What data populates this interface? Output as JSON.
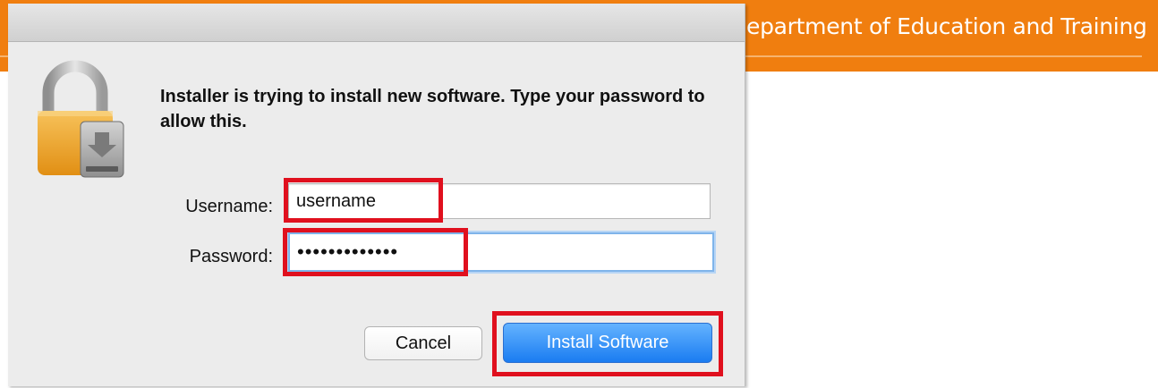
{
  "banner": {
    "title": "epartment of Education and Training",
    "color": "#f07e0f"
  },
  "dialog": {
    "icon": "lock-icon",
    "message": "Installer is trying to install new software. Type your password to allow this.",
    "username_label": "Username:",
    "username_value": "username",
    "password_label": "Password:",
    "password_value": "•••••••••••••",
    "cancel_label": "Cancel",
    "install_label": "Install Software",
    "accent": "#1a7cf1",
    "highlight_color": "#e0101e"
  }
}
